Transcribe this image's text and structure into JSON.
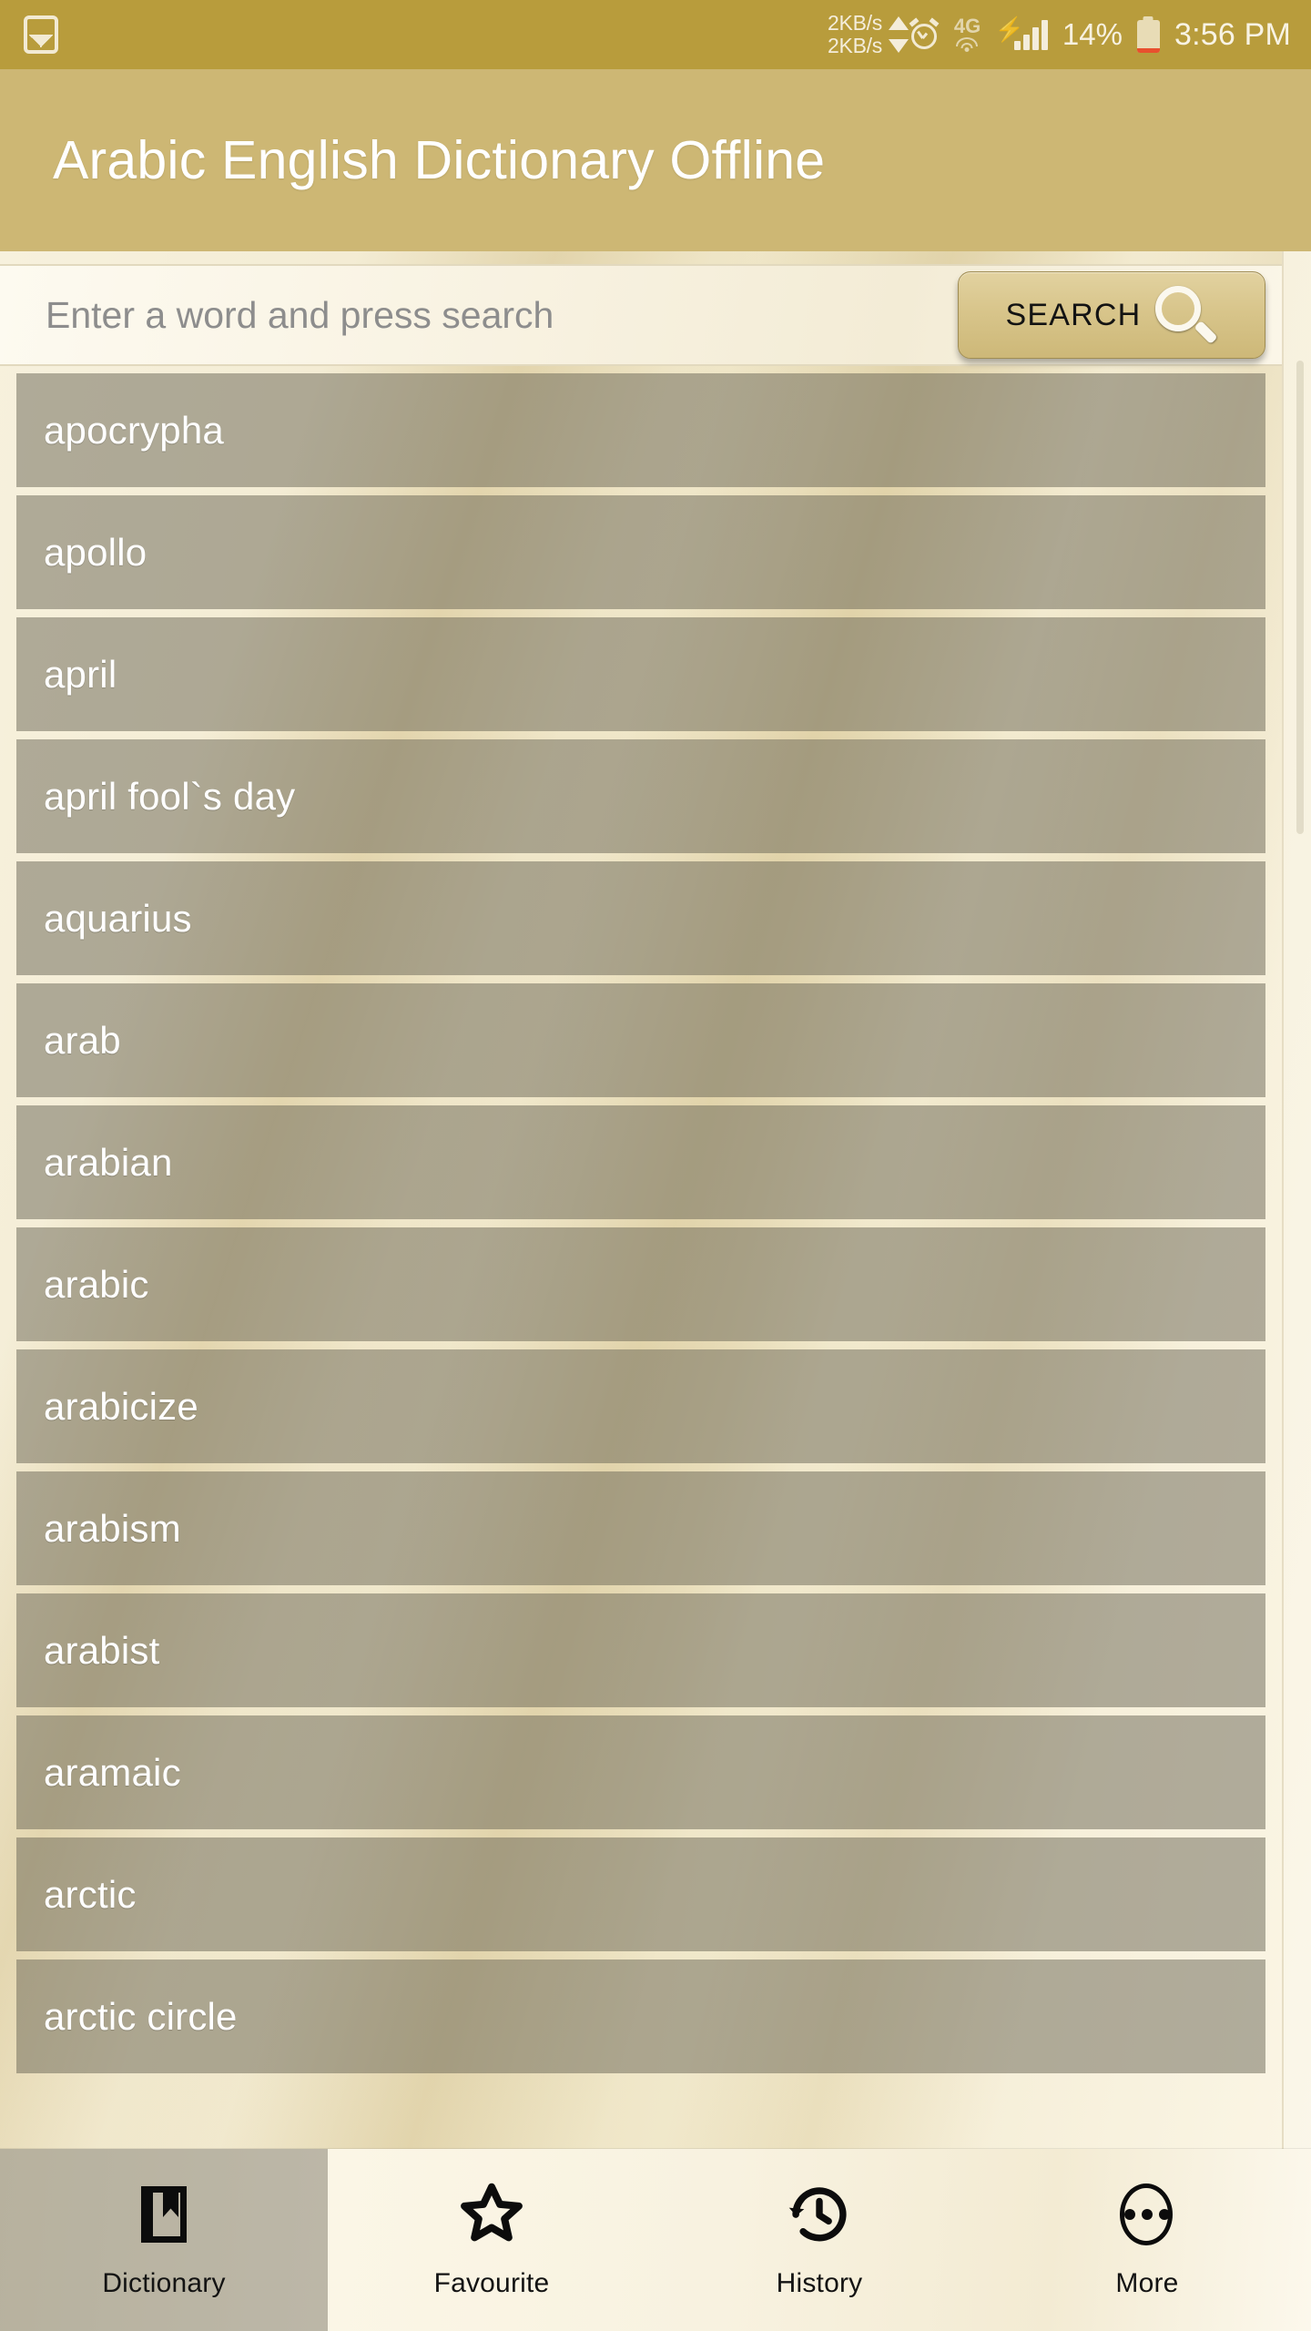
{
  "status_bar": {
    "notification_icon": "image-notification-icon",
    "network_speed_up": "2KB/s",
    "network_speed_down": "2KB/s",
    "alarm_icon": "alarm-clock-icon",
    "network_type": "4G",
    "wifi_icon": "wifi-icon",
    "signal_icon": "signal-bars-icon",
    "battery_percent": "14%",
    "battery_icon": "battery-low-icon",
    "time": "3:56 PM"
  },
  "app_bar": {
    "title": "Arabic English Dictionary Offline"
  },
  "search": {
    "value": "",
    "placeholder": "Enter a word and press search",
    "button_label": "SEARCH",
    "button_icon": "magnifier-icon"
  },
  "word_list": {
    "items": [
      "apocrypha",
      "apollo",
      "april",
      "april fool`s day",
      "aquarius",
      "arab",
      "arabian",
      "arabic",
      "arabicize",
      "arabism",
      "arabist",
      "aramaic",
      "arctic",
      "arctic circle"
    ]
  },
  "bottom_nav": {
    "tabs": [
      {
        "label": "Dictionary",
        "icon": "book-icon",
        "active": true
      },
      {
        "label": "Favourite",
        "icon": "star-icon",
        "active": false
      },
      {
        "label": "History",
        "icon": "history-clock-icon",
        "active": false
      },
      {
        "label": "More",
        "icon": "more-ellipsis-icon",
        "active": false
      }
    ]
  },
  "colors": {
    "status_bar_bg": "#b89c3c",
    "app_bar_bg": "#cdb774",
    "page_bg": "#f3ecd6",
    "row_bg": "rgba(104,100,84,0.50)",
    "accent": "#cdb878",
    "battery_low": "#e8502e",
    "text_on_row": "#ffffff"
  }
}
